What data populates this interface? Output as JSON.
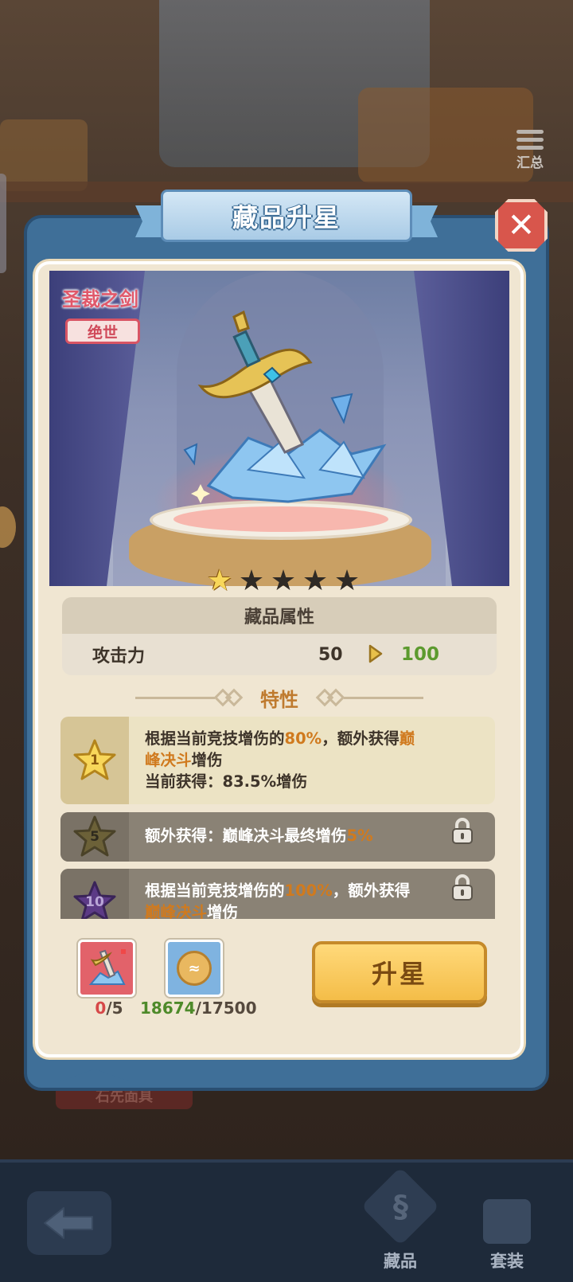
{
  "header": {
    "summary_label": "汇总"
  },
  "modal": {
    "title": "藏品升星",
    "close_icon": "close-icon"
  },
  "item": {
    "name": "圣裁之剑",
    "rarity": "绝世",
    "stars_total": 5,
    "stars_lit": 1
  },
  "attributes": {
    "header": "藏品属性",
    "rows": [
      {
        "name": "攻击力",
        "current": "50",
        "next": "100"
      }
    ]
  },
  "traits": {
    "header": "特性",
    "items": [
      {
        "level": "1",
        "unlocked": true,
        "line1_a": "根据当前竞技增伤的",
        "line1_hl": "80%",
        "line1_b": "，额外获得",
        "line1_hl2": "巅",
        "line2_hl": "峰决斗",
        "line2_b": "增伤",
        "line3": "当前获得：83.5%增伤"
      },
      {
        "level": "5",
        "unlocked": false,
        "text_a": "额外获得：巅峰决斗最终增伤",
        "text_hl": "5%"
      },
      {
        "level": "10",
        "unlocked": false,
        "line1_a": "根据当前竞技增伤的",
        "line1_hl": "100%",
        "line1_b": "，额外获得",
        "line2_hl": "巅峰决斗",
        "line2_b": "增伤"
      }
    ]
  },
  "cost": {
    "shard_have": "0",
    "shard_need": "/5",
    "coin_have": "18674",
    "coin_need": "/17500"
  },
  "upgrade_button": "升星",
  "bottom_nav": {
    "collection": "藏品",
    "set": "套装",
    "back_icon": "arrow-left-icon"
  },
  "behind_label": "石先面具",
  "colors": {
    "accent_gold": "#f4bd48",
    "highlight_orange": "#d07a1e",
    "value_green": "#5c9a2e",
    "rarity_red": "#d85464",
    "panel_blue": "#3f6f98"
  }
}
